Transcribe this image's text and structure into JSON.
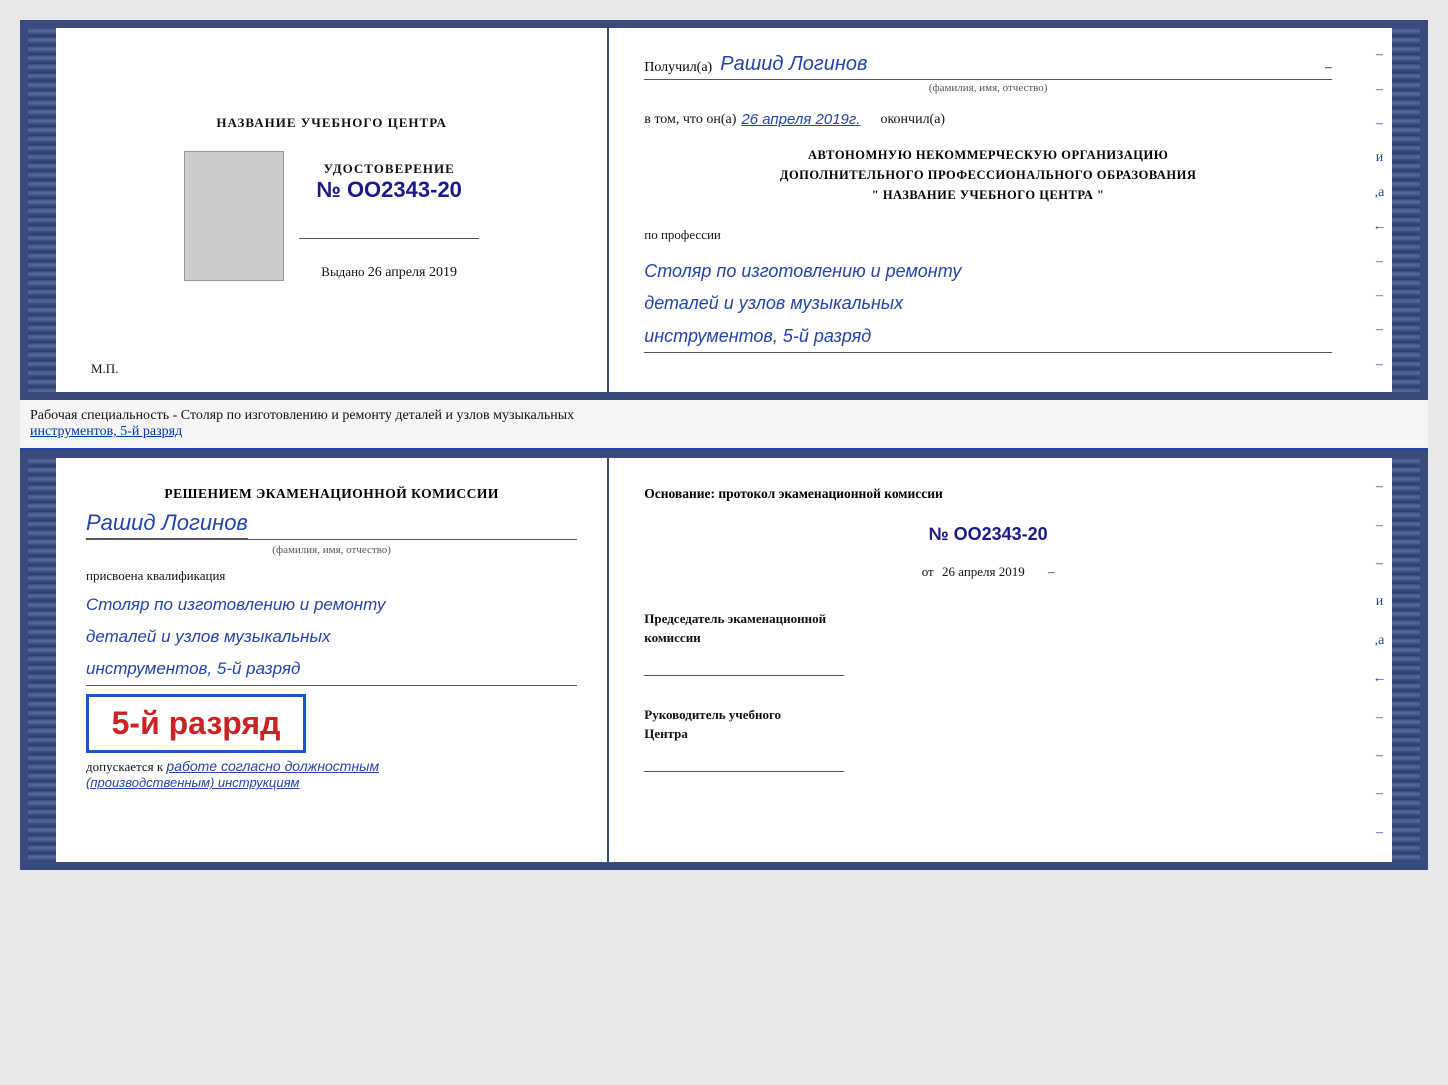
{
  "topDoc": {
    "left": {
      "centerTitle": "НАЗВАНИЕ УЧЕБНОГО ЦЕНТРА",
      "certLabel": "УДОСТОВЕРЕНИЕ",
      "certNumber": "№ OO2343-20",
      "issuedLabel": "Выдано",
      "issuedDate": "26 апреля 2019",
      "mpLabel": "М.П."
    },
    "right": {
      "receivedLabel": "Получил(а)",
      "recipientName": "Рашид Логинов",
      "fioHint": "(фамилия, имя, отчество)",
      "inThatLabel": "в том, что он(а)",
      "date": "26 апреля 2019г.",
      "finishedLabel": "окончил(а)",
      "orgLine1": "АВТОНОМНУЮ НЕКОММЕРЧЕСКУЮ ОРГАНИЗАЦИЮ",
      "orgLine2": "ДОПОЛНИТЕЛЬНОГО ПРОФЕССИОНАЛЬНОГО ОБРАЗОВАНИЯ",
      "orgLine3": "\"  НАЗВАНИЕ УЧЕБНОГО ЦЕНТРА  \"",
      "professionLabel": "по профессии",
      "profLine1": "Столяр по изготовлению и ремонту",
      "profLine2": "деталей и узлов музыкальных",
      "profLine3": "инструментов, 5-й разряд"
    },
    "rightDecorations": [
      "-",
      "-",
      "–",
      "и",
      ",а",
      "←",
      "–",
      "–",
      "–",
      "–"
    ]
  },
  "specialtyText": "Рабочая специальность - Столяр по изготовлению и ремонту деталей и узлов музыкальных",
  "specialtyText2": "инструментов, 5-й разряд",
  "bottomDoc": {
    "left": {
      "decisionTitle": "Решением экаменационной комиссии",
      "personName": "Рашид Логинов",
      "fioHint": "(фамилия, имя, отчество)",
      "qualLabel": "присвоена квалификация",
      "qualLine1": "Столяр по изготовлению и ремонту",
      "qualLine2": "деталей и узлов музыкальных",
      "qualLine3": "инструментов, 5-й разряд",
      "rankBadge": "5-й разряд",
      "allowedLabel": "допускается к",
      "allowedText": "работе согласно должностным",
      "allowedText2": "(производственным) инструкциям"
    },
    "right": {
      "basisLabel": "Основание: протокол экаменационной комиссии",
      "protocolNumber": "№ OO2343-20",
      "fromLabel": "от",
      "fromDate": "26 апреля 2019",
      "chairmanLabel": "Председатель экаменационной\nкомиссии",
      "directorLabel": "Руководитель учебного\nЦентра"
    },
    "rightDecorations": [
      "-",
      "-",
      "–",
      "и",
      ",а",
      "←",
      "–",
      "–",
      "–",
      "–"
    ]
  }
}
